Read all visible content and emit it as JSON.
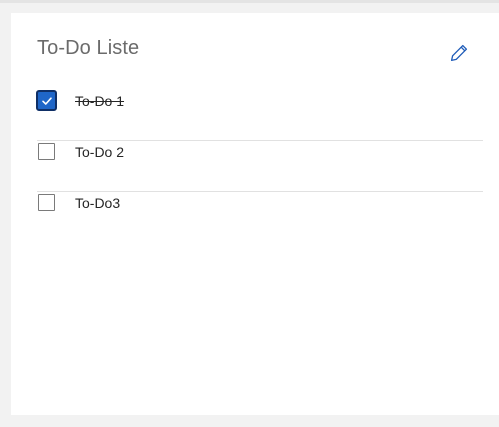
{
  "card": {
    "title": "To-Do Liste",
    "edit_icon": "pencil-icon"
  },
  "todos": [
    {
      "label": "To-Do 1",
      "checked": true
    },
    {
      "label": "To-Do 2",
      "checked": false
    },
    {
      "label": "To-Do3",
      "checked": false
    }
  ],
  "colors": {
    "checkbox_checked_fill": "#1f66c8",
    "checkbox_checked_border": "#0f2f66",
    "edit_icon": "#1e5bb8",
    "page_background": "#f2f2f2"
  }
}
